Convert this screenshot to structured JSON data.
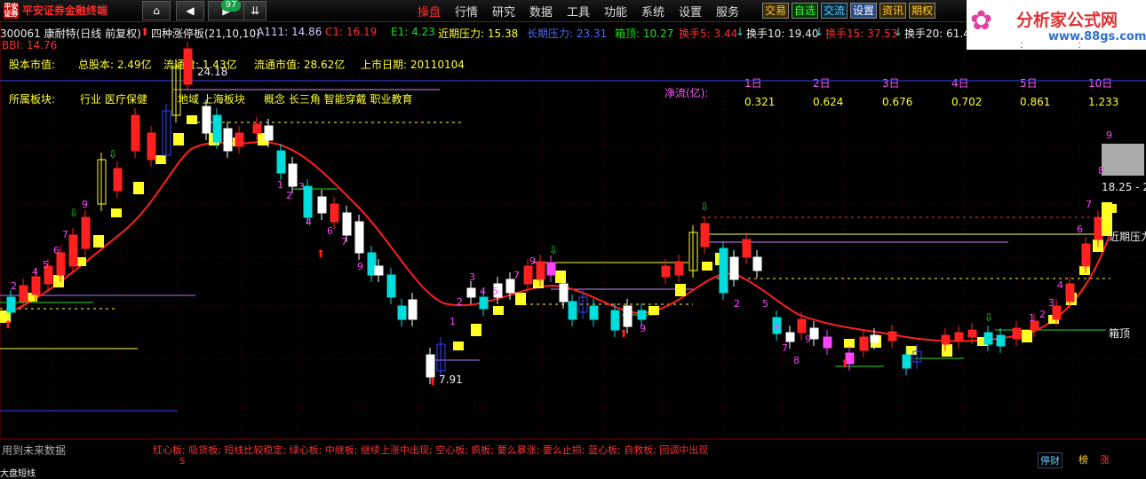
{
  "app": {
    "brand": "平安证券金融终端",
    "logo_text": "平安证券",
    "badge": "97"
  },
  "nav": {
    "home_icon": "home-icon",
    "back_icon": "left-arrow-icon",
    "fwd_icon": "right-arrow-icon",
    "down_icon": "double-chevron-down-icon"
  },
  "menu": [
    "操盘",
    "行情",
    "研究",
    "数据",
    "工具",
    "功能",
    "系统",
    "设置",
    "服务"
  ],
  "quick_buttons": [
    {
      "label": "交易",
      "color": "#ffcc44"
    },
    {
      "label": "自选",
      "color": "#44ff44"
    },
    {
      "label": "交流",
      "color": "#66ccff"
    },
    {
      "label": "设置",
      "color": "#ffffff"
    },
    {
      "label": "资讯",
      "color": "#ffcc44"
    },
    {
      "label": "期权",
      "color": "#ffcc44"
    }
  ],
  "watermark": {
    "title": "分析家公式网",
    "url": "www.88gs.com"
  },
  "stock": {
    "code_name": "300061 康耐特(日线 前复权)",
    "indicator": "四种涨停板(21,10,10)",
    "a111": "A111: 14.86",
    "c1": "C1: 16.19",
    "e1": "E1: 4.23",
    "near_pressure": "近期压力: 15.38",
    "long_pressure": "长期压力: 23.31",
    "box_top": "箱顶: 10.27",
    "turn5": "换手5: 3.44",
    "turn10": "换手10: 19.40",
    "turn15": "换手15: 37.53",
    "turn20": "换手20: 61.4"
  },
  "bbi": "BBI: 14.76",
  "fund": {
    "market_value_label": "股本市值:",
    "total_shares": "总股本: 2.49亿",
    "float_shares": "流通盘: 1.43亿",
    "float_value": "流通市值: 28.62亿",
    "list_date": "上市日期: 20110104",
    "sector_label": "所属板块:",
    "industry": "行业  医疗保健",
    "region": "地域  上海板块",
    "concept": "概念  长三角 智能穿戴 职业教育"
  },
  "netflow": {
    "label": "净流(亿):",
    "days": [
      "1日",
      "2日",
      "3日",
      "4日",
      "5日",
      "10日"
    ],
    "values": [
      "0.321",
      "0.624",
      "0.676",
      "0.702",
      "0.861",
      "1.233"
    ]
  },
  "price_labels": {
    "high": "24.18",
    "low": "7.91",
    "right_price": "18.25 - 2",
    "near": "近期压力",
    "box": "箱顶"
  },
  "bottom": {
    "future_note": "用到未来数据",
    "legend": "红心板; 吸货板; 短线比较稳定; 绿心板; 中继板; 继续上涨中出现; 空心板; 疯板; 要么暴涨; 要么止损; 蓝心板; 自救板; 回调中出现",
    "btn1": "停财",
    "btn2": "榜",
    "btn3": "涨",
    "bottom_text": "大盘短线"
  }
}
